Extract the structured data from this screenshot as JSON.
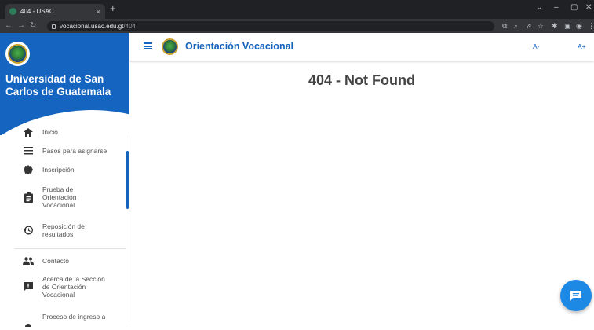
{
  "browser": {
    "tab_title": "404 - USAC",
    "tab_close": "×",
    "new_tab": "+",
    "url_host": "vocacional.usac.edu.gt",
    "url_path": "/404",
    "win_min": "–",
    "win_max": "▢",
    "win_close": "✕"
  },
  "sidebar": {
    "university_name": "Universidad de San Carlos de Guatemala",
    "items": [
      {
        "label": "Inicio",
        "icon": "home-icon"
      },
      {
        "label": "Pasos para asignarse",
        "icon": "list-icon"
      },
      {
        "label": "Inscripción",
        "icon": "badge-icon"
      },
      {
        "label": "Prueba de Orientación Vocacional",
        "icon": "clipboard-icon"
      },
      {
        "label": "Reposición de resultados",
        "icon": "history-icon"
      },
      {
        "label": "Contacto",
        "icon": "people-icon"
      },
      {
        "label": "Acerca de la Sección de Orientación Vocacional",
        "icon": "info-chat-icon"
      },
      {
        "label": "Proceso de ingreso a",
        "icon": "process-icon"
      }
    ]
  },
  "appbar": {
    "title": "Orientación Vocacional",
    "font_decrease": "A-",
    "font_increase": "A+"
  },
  "main": {
    "title": "404 - Not Found"
  },
  "colors": {
    "primary": "#1565c0",
    "fab": "#1e88e5"
  }
}
